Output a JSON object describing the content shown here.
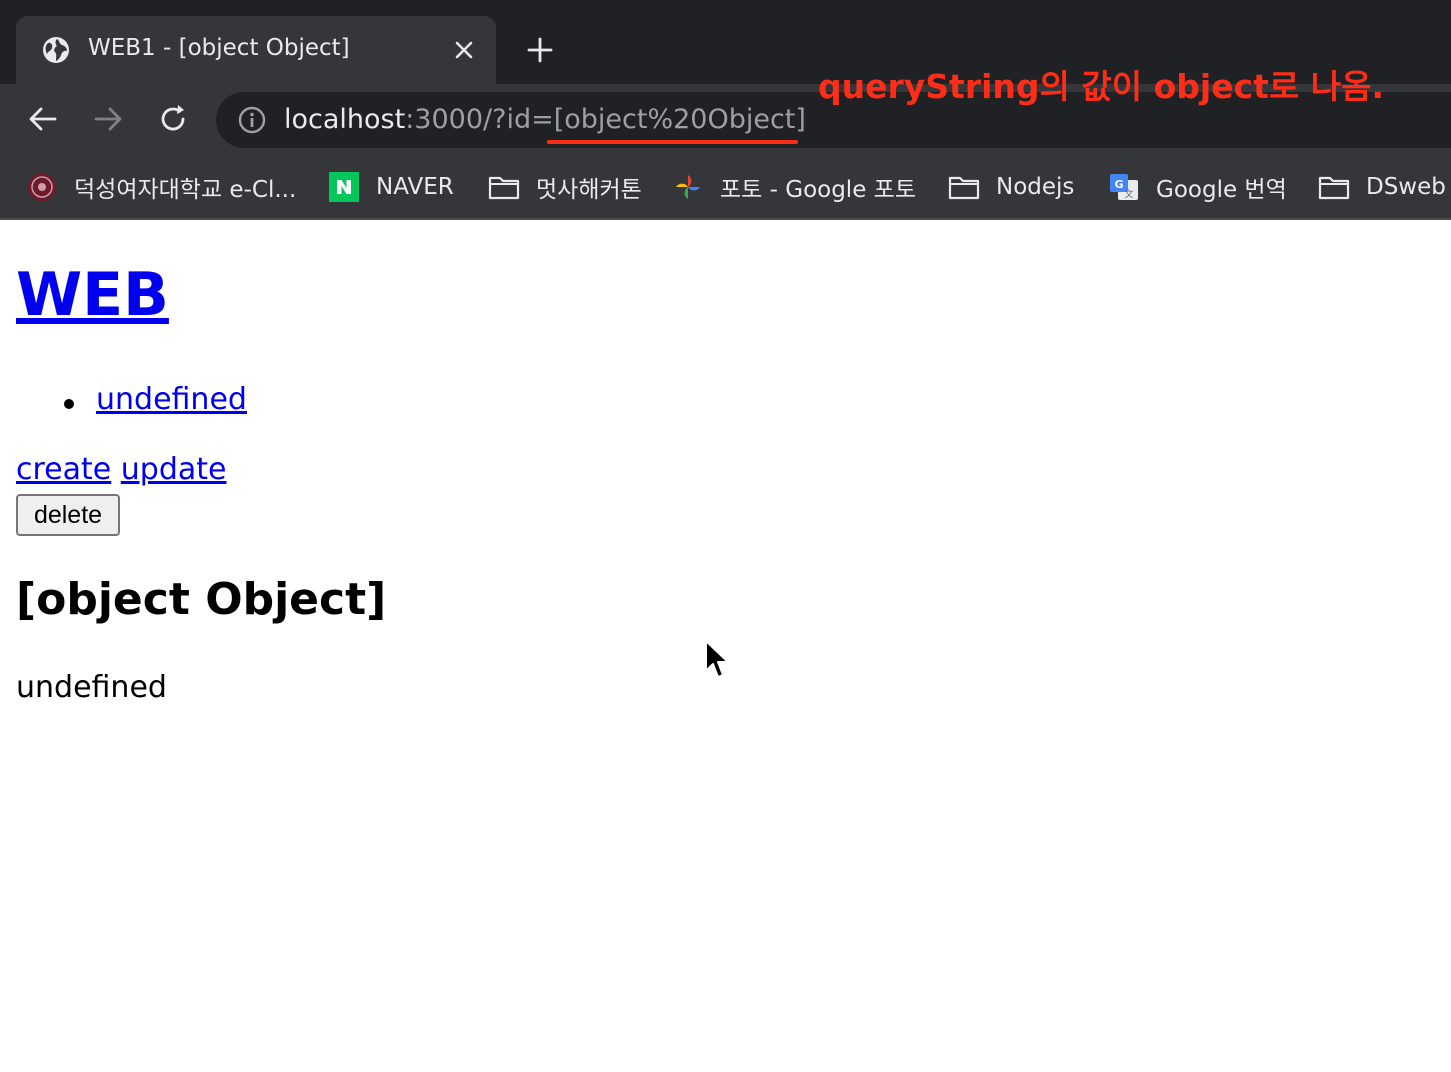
{
  "browser": {
    "tab": {
      "title": "WEB1 - [object Object]"
    },
    "address": {
      "host": "localhost",
      "rest": ":3000/?id=[object%20Object]"
    },
    "bookmarks": [
      {
        "label": "덕성여자대학교 e-Cl...",
        "icon": "university-logo-icon"
      },
      {
        "label": "NAVER",
        "icon": "naver-icon"
      },
      {
        "label": "멋사해커톤",
        "icon": "folder-icon"
      },
      {
        "label": "포토 - Google 포토",
        "icon": "google-photos-icon"
      },
      {
        "label": "Nodejs",
        "icon": "folder-icon"
      },
      {
        "label": "Google 번역",
        "icon": "google-translate-icon"
      },
      {
        "label": "DSweb",
        "icon": "folder-icon"
      }
    ]
  },
  "annotation": {
    "text": "queryString의 값이 object로 나옴."
  },
  "page": {
    "heading": "WEB",
    "list": [
      "undefined"
    ],
    "links": {
      "create": "create",
      "update": "update"
    },
    "delete_label": "delete",
    "title": "[object Object]",
    "description": "undefined"
  },
  "colors": {
    "chrome_dark": "#202124",
    "chrome_toolbar": "#35363a",
    "annotation": "#ff2d17",
    "link": "#0000ee"
  }
}
